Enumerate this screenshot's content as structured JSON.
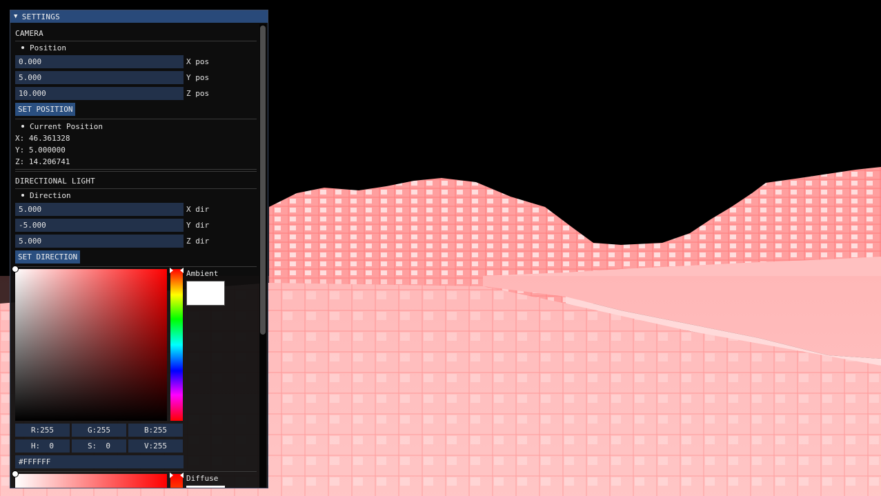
{
  "window": {
    "title": "SETTINGS"
  },
  "camera": {
    "header": "CAMERA",
    "position_label": "Position",
    "x_value": "0.000",
    "x_label": "X pos",
    "y_value": "5.000",
    "y_label": "Y pos",
    "z_value": "10.000",
    "z_label": "Z pos",
    "set_button": "SET POSITION",
    "current_label": "Current Position",
    "current_x": "X: 46.361328",
    "current_y": "Y: 5.000000",
    "current_z": "Z: 14.206741"
  },
  "light": {
    "header": "DIRECTIONAL LIGHT",
    "direction_label": "Direction",
    "x_value": "5.000",
    "x_label": "X dir",
    "y_value": "-5.000",
    "y_label": "Y dir",
    "z_value": "5.000",
    "z_label": "Z dir",
    "set_button": "SET DIRECTION",
    "ambient": {
      "label": "Ambient",
      "r": "R:255",
      "g": "G:255",
      "b": "B:255",
      "h": "H:  0",
      "s": "S:  0",
      "v": "V:255",
      "hex": "#FFFFFF",
      "color": "#FFFFFF"
    },
    "diffuse": {
      "label": "Diffuse",
      "color": "#FFFFFF"
    }
  },
  "colors": {
    "title_bar": "#294a7a",
    "field_bg": "#22314a",
    "button_bg": "#2a4f80",
    "terrain": "#ffb3b3"
  }
}
